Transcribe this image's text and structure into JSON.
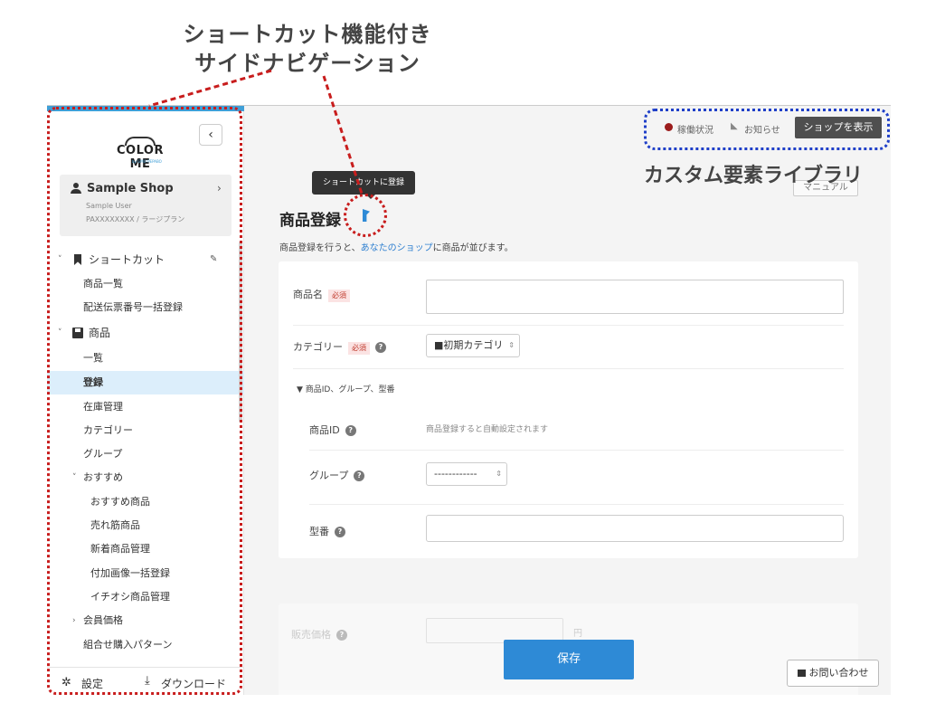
{
  "annotations": {
    "title_line1": "ショートカット機能付き",
    "title_line2": "サイドナビゲーション",
    "custom_library": "カスタム要素ライブラリ"
  },
  "colors": {
    "accent": "#2e8ad6",
    "annotation_red": "#c81d1d",
    "annotation_blue": "#1f3fc8",
    "dark_button": "#4f4f4f"
  },
  "sidebar": {
    "logo_text": "COLOR ME",
    "logo_sub": "by GMO PEPABO",
    "collapse_icon": "‹",
    "shop": {
      "name": "Sample Shop",
      "chevron": "›",
      "user": "Sample User",
      "plan": "PAXXXXXXXX / ラージプラン"
    },
    "shortcut": {
      "caret": "˅",
      "label": "ショートカット",
      "items": [
        "商品一覧",
        "配送伝票番号一括登録"
      ]
    },
    "products": {
      "caret": "˅",
      "label": "商品",
      "items": [
        "一覧",
        "登録",
        "在庫管理",
        "カテゴリー",
        "グループ"
      ],
      "active_item": "登録"
    },
    "recommend": {
      "caret": "˅",
      "label": "おすすめ",
      "items": [
        "おすすめ商品",
        "売れ筋商品",
        "新着商品管理",
        "付加画像一括登録",
        "イチオシ商品管理"
      ]
    },
    "member_price": {
      "caret": "›",
      "label": "会員価格"
    },
    "combo": "組合せ購入パターン",
    "footer": {
      "settings": "設定",
      "download": "ダウンロード"
    }
  },
  "header": {
    "status": "稼働状況",
    "news": "お知らせ",
    "show_shop": "ショップを表示"
  },
  "page": {
    "tooltip": "ショートカットに登録",
    "manual": "マニュアル",
    "title": "商品登録",
    "desc_prefix": "商品登録を行うと、",
    "desc_link": "あなたのショップ",
    "desc_suffix": "に商品が並びます。"
  },
  "form": {
    "name_label": "商品名",
    "required": "必須",
    "category_label": "カテゴリー",
    "category_value": "■初期カテゴリ",
    "details_toggle": "▼ 商品ID、グループ、型番",
    "id_label": "商品ID",
    "id_note": "商品登録すると自動設定されます",
    "group_label": "グループ",
    "group_value": "------------",
    "model_label": "型番",
    "price_label": "販売価格",
    "yen": "円",
    "help": "?",
    "select_arrow": "⌃⌄"
  },
  "actions": {
    "save": "保存",
    "contact": "お問い合わせ"
  }
}
